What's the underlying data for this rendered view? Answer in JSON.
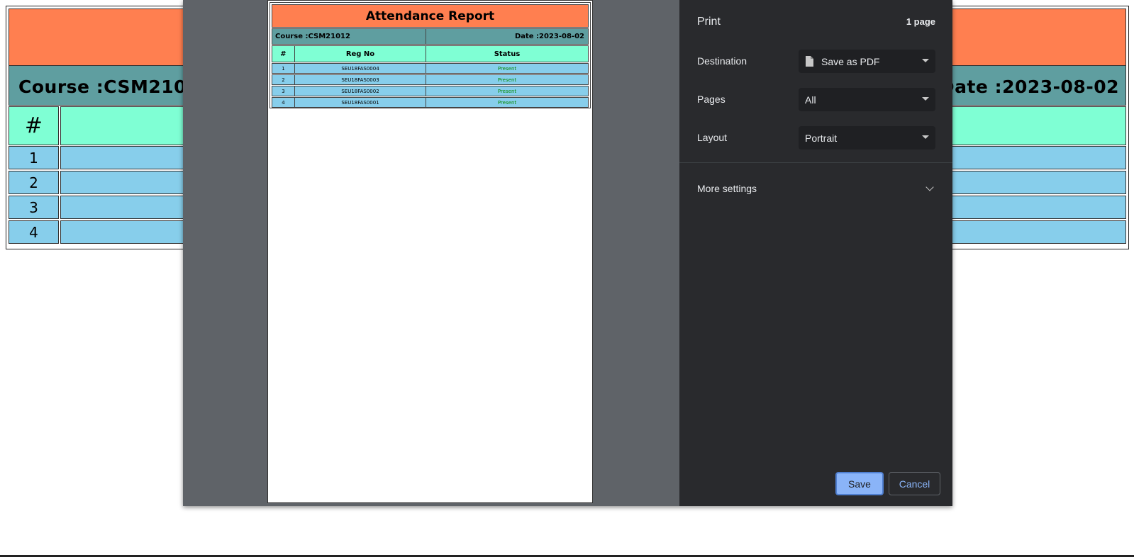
{
  "background": {
    "course": "Course :CSM21012",
    "date": "Date :2023-08-02",
    "hash": "#",
    "row_numbers": [
      "1",
      "2",
      "3",
      "4"
    ]
  },
  "preview": {
    "title": "Attendance Report",
    "course": "Course :CSM21012",
    "date": "Date :2023-08-02",
    "headers": [
      "#",
      "Reg No",
      "Status"
    ],
    "rows": [
      {
        "num": "1",
        "reg": "SEU18FAS0004",
        "status": "Present"
      },
      {
        "num": "2",
        "reg": "SEU18FAS0003",
        "status": "Present"
      },
      {
        "num": "3",
        "reg": "SEU18FAS0002",
        "status": "Present"
      },
      {
        "num": "4",
        "reg": "SEU18FAS0001",
        "status": "Present"
      }
    ],
    "colors": {
      "title_bg": "#ff7f50",
      "info_bg": "#5f9ea0",
      "header_bg": "#7fffd4",
      "row_bg": "#87ceeb",
      "status_text": "#0a8a0a"
    }
  },
  "print": {
    "title": "Print",
    "page_count": "1 page",
    "destination_label": "Destination",
    "destination_value": "Save as PDF",
    "destination_icon": "file-icon",
    "pages_label": "Pages",
    "pages_value": "All",
    "layout_label": "Layout",
    "layout_value": "Portrait",
    "more_settings": "More settings",
    "save": "Save",
    "cancel": "Cancel"
  }
}
